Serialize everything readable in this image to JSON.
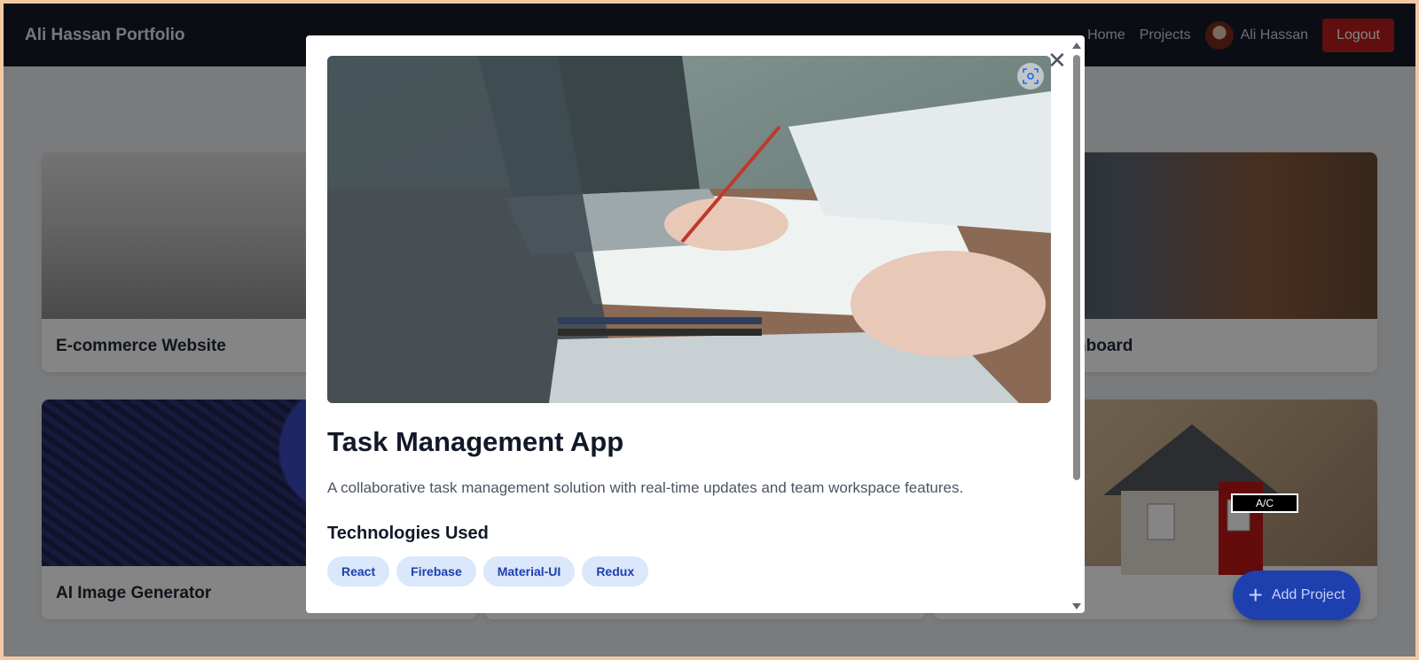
{
  "navbar": {
    "brand": "Ali Hassan Portfolio",
    "links": [
      "Home",
      "Projects"
    ],
    "user_name": "Ali Hassan",
    "logout_label": "Logout"
  },
  "cards": [
    {
      "title": "E-commerce Website"
    },
    {
      "title": "nboard"
    },
    {
      "title": "AI Image Generator"
    }
  ],
  "badge_label": "A/C",
  "add_project_label": "Add Project",
  "modal": {
    "title": "Task Management App",
    "description": "A collaborative task management solution with real-time updates and team workspace features.",
    "tech_heading": "Technologies Used",
    "technologies": [
      "React",
      "Firebase",
      "Material-UI",
      "Redux"
    ]
  },
  "colors": {
    "navbar": "#141a28",
    "logout": "#b91c1c",
    "add_button": "#1e40af",
    "tag_bg": "#dbe7fb",
    "tag_text": "#1e40af"
  }
}
